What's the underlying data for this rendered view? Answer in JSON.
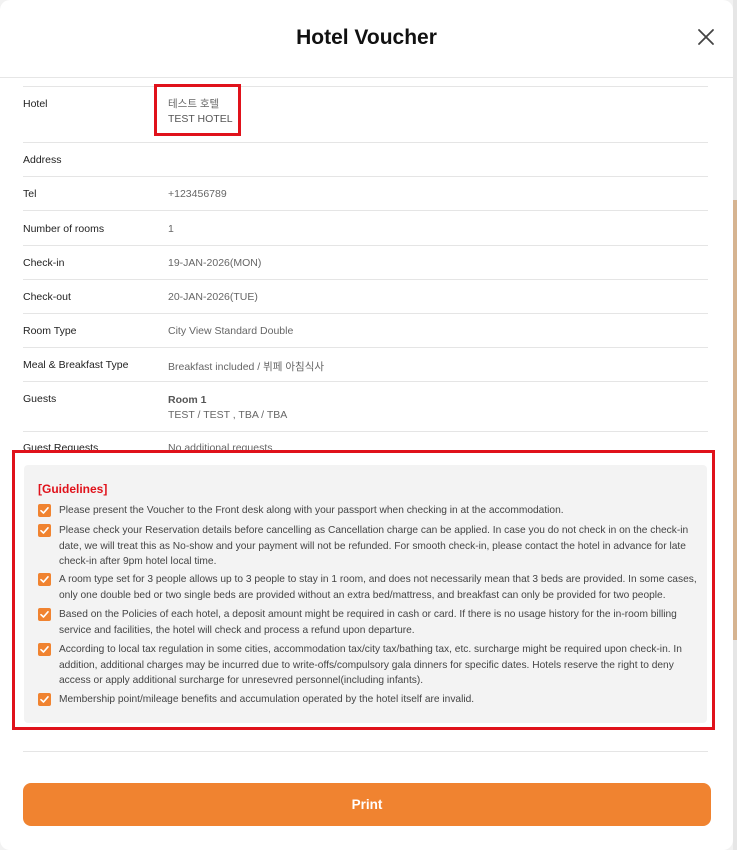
{
  "modal": {
    "title": "Hotel Voucher",
    "print_label": "Print"
  },
  "colors": {
    "accent": "#f08330",
    "highlight": "#e0121b"
  },
  "icons": {
    "close": "close-icon",
    "check": "check-icon"
  },
  "rows": {
    "hotel": {
      "label": "Hotel",
      "value_ko": "테스트 호텔",
      "value_en": "TEST HOTEL"
    },
    "address": {
      "label": "Address",
      "value": ""
    },
    "tel": {
      "label": "Tel",
      "value": "+123456789"
    },
    "rooms": {
      "label": "Number of rooms",
      "value": "1"
    },
    "checkin": {
      "label": "Check-in",
      "value": "19-JAN-2026(MON)"
    },
    "checkout": {
      "label": "Check-out",
      "value": "20-JAN-2026(TUE)"
    },
    "roomtype": {
      "label": "Room Type",
      "value": "City View Standard Double"
    },
    "meal": {
      "label": "Meal & Breakfast Type",
      "value": "Breakfast included / 뷔페 아침식사"
    },
    "guests": {
      "label": "Guests",
      "room": "Room 1",
      "names": "TEST / TEST , TBA / TBA"
    },
    "requests": {
      "label": "Guest Requests",
      "value": "No additional requests"
    }
  },
  "guidelines": {
    "title": "[Guidelines]",
    "items": [
      "Please present the Voucher to the Front desk along with your passport when checking in at the accommodation.",
      "Please check your Reservation details before cancelling as Cancellation charge can be applied. In case you do not check in on the check-in date, we will treat this as No-show and your payment will not be refunded. For smooth check-in, please contact the hotel in advance for late check-in after 9pm hotel local time.",
      "A room type set for 3 people allows up to 3 people to stay in 1 room, and does not necessarily mean that 3 beds are provided. In some cases, only one double bed or two single beds are provided without an extra bed/mattress, and breakfast can only be provided for two people.",
      "Based on the Policies of each hotel, a deposit amount might be required in cash or card. If there is no usage history for the in-room billing service and facilities, the hotel will check and process a refund upon departure.",
      "According to local tax regulation in some cities, accommodation tax/city tax/bathing tax, etc. surcharge might be required upon check-in. In addition, additional charges may be incurred due to write-offs/compulsory gala dinners for specific dates. Hotels reserve the right to deny access or apply additional surcharge for unresevred personnel(including infants).",
      "Membership point/mileage benefits and accumulation operated by the hotel itself are invalid."
    ]
  }
}
